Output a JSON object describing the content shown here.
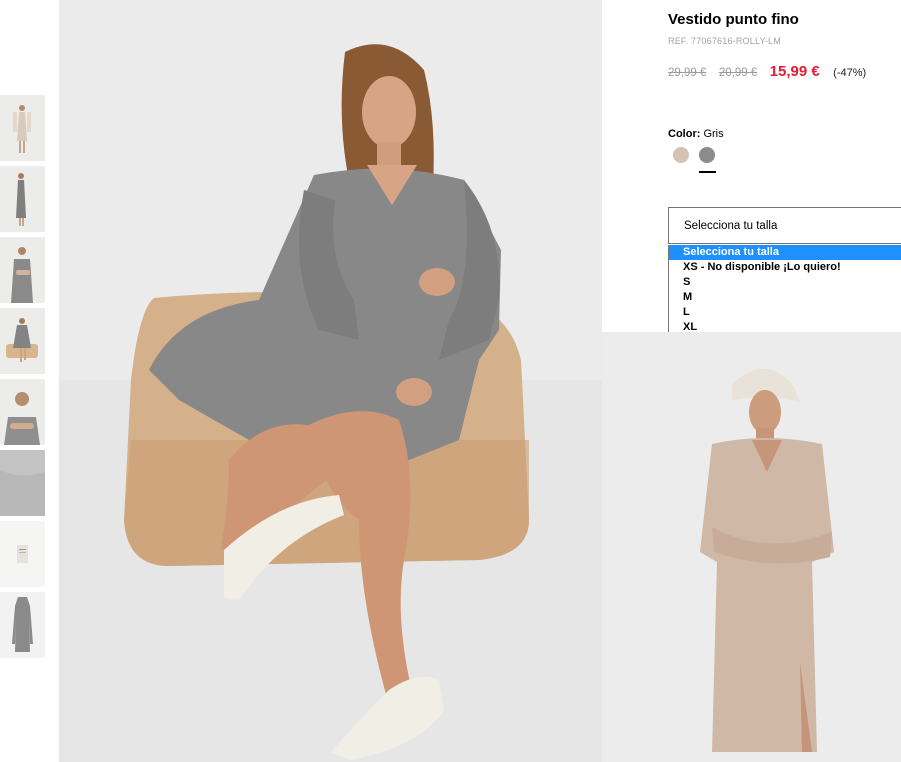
{
  "product": {
    "title": "Vestido punto fino",
    "ref": "REF. 77067616-ROLLY-LM",
    "price_original": "29,99 €",
    "price_previous": "20,99 €",
    "price_current": "15,99 €",
    "discount": "(-47%)"
  },
  "color": {
    "label": "Color:",
    "selected": "Gris",
    "swatches": [
      {
        "name": "beige",
        "hex": "#d2c3b4"
      },
      {
        "name": "gris",
        "hex": "#8c8c8c"
      }
    ]
  },
  "size": {
    "placeholder": "Selecciona tu talla",
    "options": [
      "Selecciona tu talla",
      "XS - No disponible ¡Lo quiero!",
      "S",
      "M",
      "L",
      "XL"
    ]
  },
  "colors": {
    "sale_red": "#e41b31",
    "select_highlight": "#1e90ff"
  }
}
